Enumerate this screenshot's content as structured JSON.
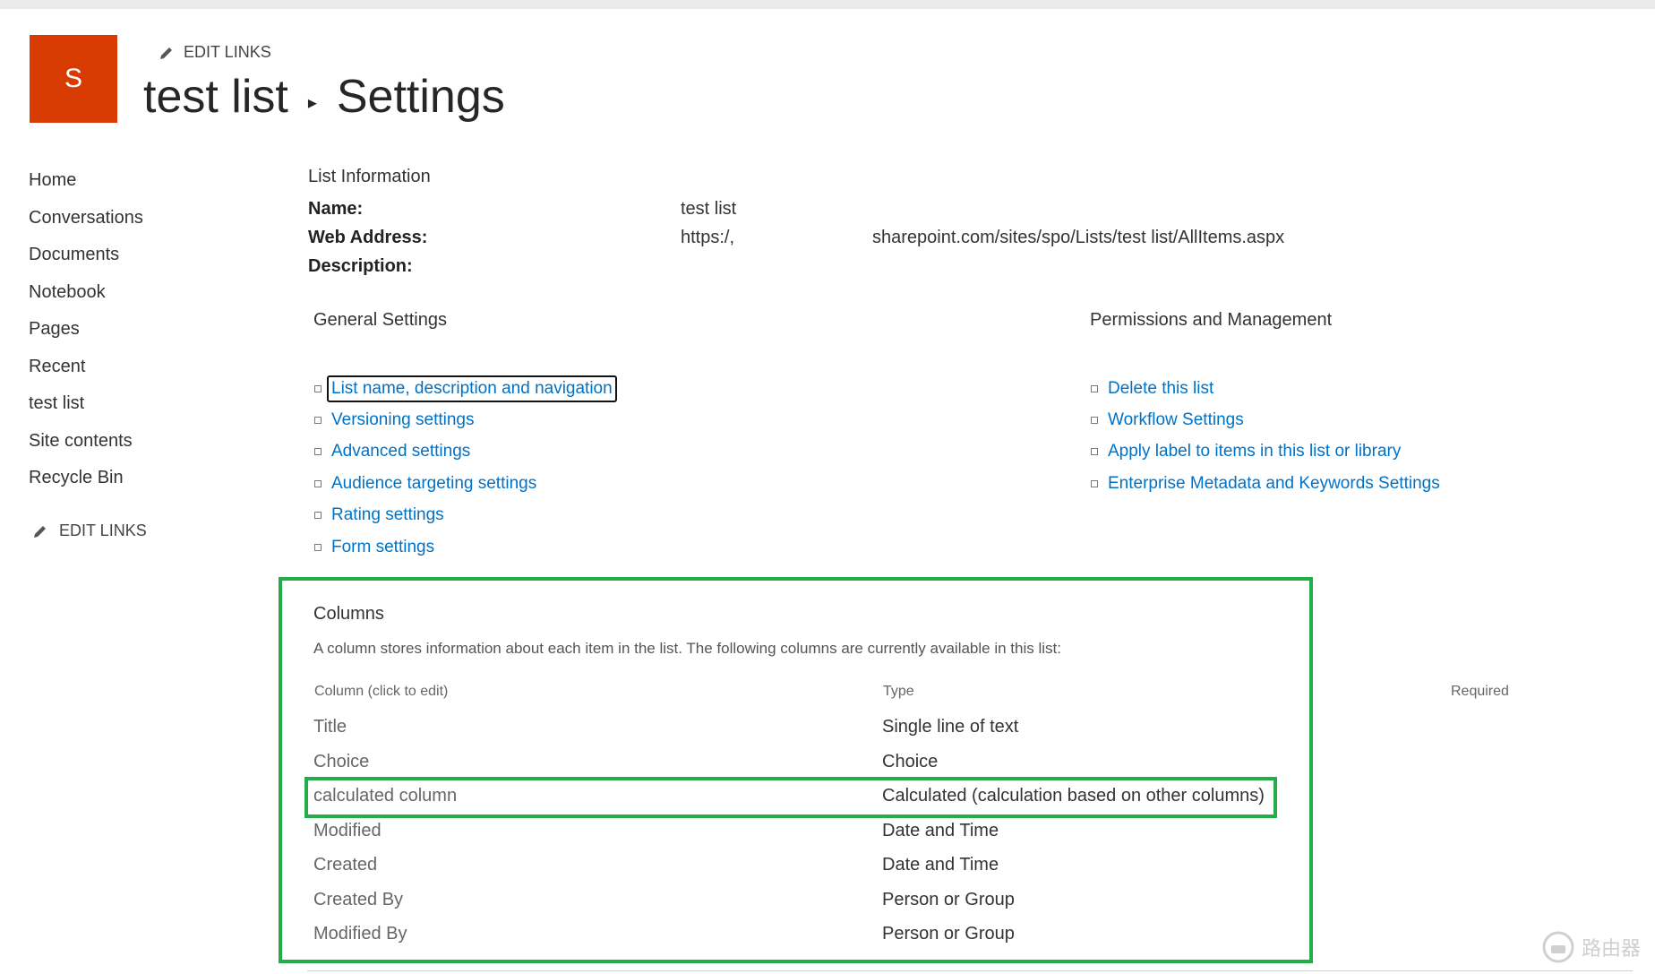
{
  "header": {
    "logo_letter": "S",
    "edit_links": "EDIT LINKS",
    "title_parent": "test list",
    "title_current": "Settings"
  },
  "nav": {
    "items": [
      "Home",
      "Conversations",
      "Documents",
      "Notebook",
      "Pages",
      "Recent",
      "test list",
      "Site contents",
      "Recycle Bin"
    ],
    "edit_links": "EDIT LINKS"
  },
  "list_info": {
    "heading": "List Information",
    "name_label": "Name:",
    "name_value": "test list",
    "web_address_label": "Web Address:",
    "web_address_prefix": "https:/,",
    "web_address_suffix": "sharepoint.com/sites/spo/Lists/test list/AllItems.aspx",
    "description_label": "Description:"
  },
  "general_settings": {
    "heading": "General Settings",
    "links": [
      "List name, description and navigation",
      "Versioning settings",
      "Advanced settings",
      "Audience targeting settings",
      "Rating settings",
      "Form settings"
    ]
  },
  "permissions": {
    "heading": "Permissions and Management",
    "links": [
      "Delete this list",
      "Workflow Settings",
      "Apply label to items in this list or library",
      "Enterprise Metadata and Keywords Settings"
    ]
  },
  "columns": {
    "heading": "Columns",
    "description": "A column stores information about each item in the list. The following columns are currently available in this list:",
    "headers": {
      "column": "Column (click to edit)",
      "type": "Type",
      "required": "Required"
    },
    "rows": [
      {
        "name": "Title",
        "type": "Single line of text"
      },
      {
        "name": "Choice",
        "type": "Choice"
      },
      {
        "name": "calculated column",
        "type": "Calculated (calculation based on other columns)"
      },
      {
        "name": "Modified",
        "type": "Date and Time"
      },
      {
        "name": "Created",
        "type": "Date and Time"
      },
      {
        "name": "Created By",
        "type": "Person or Group"
      },
      {
        "name": "Modified By",
        "type": "Person or Group"
      }
    ]
  },
  "watermark": "路由器",
  "colors": {
    "brand": "#d83b01",
    "link": "#0072c6",
    "highlight": "#22ad48"
  }
}
